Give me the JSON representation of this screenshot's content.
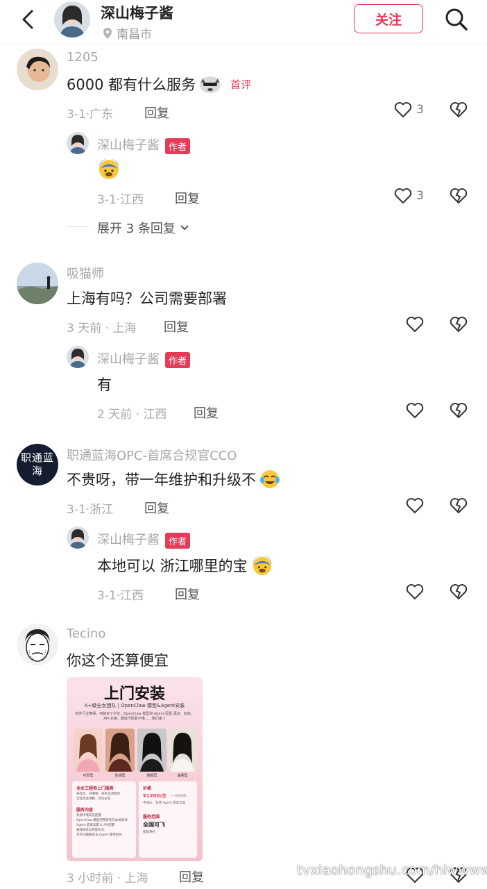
{
  "header": {
    "name": "深山梅子酱",
    "location": "南昌市",
    "follow_label": "关注"
  },
  "comments": [
    {
      "user": "1205",
      "text": "6000 都有什么服务",
      "badge": "首评",
      "date": "3-1·广东",
      "reply_label": "回复",
      "likes": "3",
      "replies": [
        {
          "user": "深山梅子酱",
          "badge": "作者",
          "text": "",
          "date": "3-1·江西",
          "reply_label": "回复",
          "likes": "3"
        }
      ],
      "expand_label": "展开 3 条回复"
    },
    {
      "user": "吸猫师",
      "text": "上海有吗？公司需要部署",
      "date": "3 天前 · 上海",
      "reply_label": "回复",
      "replies": [
        {
          "user": "深山梅子酱",
          "badge": "作者",
          "text": "有",
          "date": "2 天前 · 江西",
          "reply_label": "回复"
        }
      ]
    },
    {
      "user": "职通蓝海OPC-首席合规官CCO",
      "avatar_text": "职通蓝海",
      "text": "不贵呀，带一年维护和升级不",
      "date": "3-1·浙江",
      "reply_label": "回复",
      "replies": [
        {
          "user": "深山梅子酱",
          "badge": "作者",
          "text": "本地可以 浙江哪里的宝",
          "date": "3-1·江西",
          "reply_label": "回复"
        }
      ]
    },
    {
      "user": "Tecino",
      "text": "你这个还算便宜",
      "date": "3 小时前 · 上海",
      "reply_label": "回复",
      "image": {
        "title": "上门安装",
        "subtitle": "A+级全女团队 | OpenClaw 模型&Agent安装",
        "blurb": "软件行业懂得，电脑买了半年，OpenClaw 模型和 Agent 配置 驱动、加速、API 对接，报错代码看不懂……我们来了",
        "captions": [
          "可爱型",
          "性感型",
          "御姐型",
          "温柔型"
        ],
        "service_title": "全女工程师上门服务",
        "service_lines": [
          "开社区、开事物、开私资源框架",
          "全程温柔讲解，有问必答"
        ],
        "content_title": "服务内容",
        "content_lines": [
          "系统环境安装配置",
          "OpenClaw 模型完整安装与本地调试",
          "Agent 搭建设置 & API配置",
          "故障调试与性能优化",
          "常见问题解答与 Agent 使用指导"
        ],
        "price_title": "价格",
        "price": "¥1200/次",
        "price_note": "（一次性收费）",
        "price_sub": "不加价，现场 Agent 调试为准",
        "scope_title": "服务范围",
        "scope_main": "全国可飞",
        "scope_sub": "提前预约"
      }
    }
  ],
  "watermark": "tvxiaohongshu.com/hlwwwww",
  "colors": {
    "accent": "#e43b57",
    "muted": "#a8a8a8"
  }
}
